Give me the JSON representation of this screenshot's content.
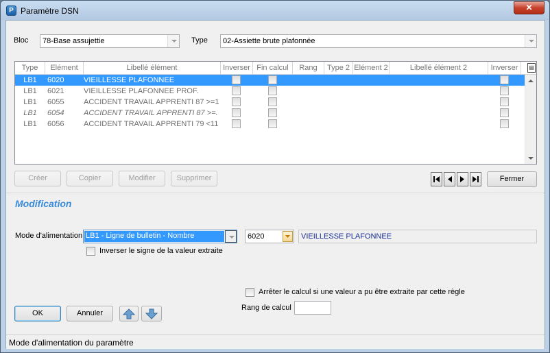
{
  "window": {
    "title": "Paramètre DSN",
    "close_label": "✕"
  },
  "filters": {
    "bloc_label": "Bloc",
    "bloc_value": "78-Base assujettie",
    "type_label": "Type",
    "type_value": "02-Assiette  brute plafonnée"
  },
  "grid": {
    "columns": [
      "Type",
      "Elément",
      "Libellé élément",
      "Inverser",
      "Fin calcul",
      "Rang",
      "Type 2",
      "Elément 2",
      "Libellé élément 2",
      "Inverser"
    ],
    "rows": [
      {
        "type": "LB1",
        "element": "6020",
        "libelle": "VIEILLESSE PLAFONNEE",
        "selected": true,
        "italic": false
      },
      {
        "type": "LB1",
        "element": "6021",
        "libelle": "VIEILLESSE PLAFONNEE  PROF.",
        "selected": false,
        "italic": false
      },
      {
        "type": "LB1",
        "element": "6055",
        "libelle": "ACCIDENT TRAVAIL APPRENTI 87 >=1",
        "selected": false,
        "italic": false
      },
      {
        "type": "LB1",
        "element": "6054",
        "libelle": "ACCIDENT TRAVAIL APPRENTI 87 >=.",
        "selected": false,
        "italic": true
      },
      {
        "type": "LB1",
        "element": "6056",
        "libelle": "ACCIDENT TRAVAIL APPRENTI 79 <11",
        "selected": false,
        "italic": false
      }
    ]
  },
  "actions": {
    "creer": "Créer",
    "copier": "Copier",
    "modifier": "Modifier",
    "supprimer": "Supprimer",
    "fermer": "Fermer"
  },
  "modification": {
    "title": "Modification",
    "mode_label": "Mode d'alimentation",
    "mode_value": "LB1 - Ligne de bulletin - Nombre",
    "element_code": "6020",
    "element_label": "VIEILLESSE PLAFONNEE",
    "inverser_label": "Inverser le signe de la valeur extraite",
    "arreter_label": "Arrêter le calcul si une valeur a pu être extraite par cette règle",
    "rang_label": "Rang de calcul",
    "rang_value": ""
  },
  "footer": {
    "ok": "OK",
    "annuler": "Annuler"
  },
  "status": {
    "text": "Mode d'alimentation du paramètre"
  }
}
